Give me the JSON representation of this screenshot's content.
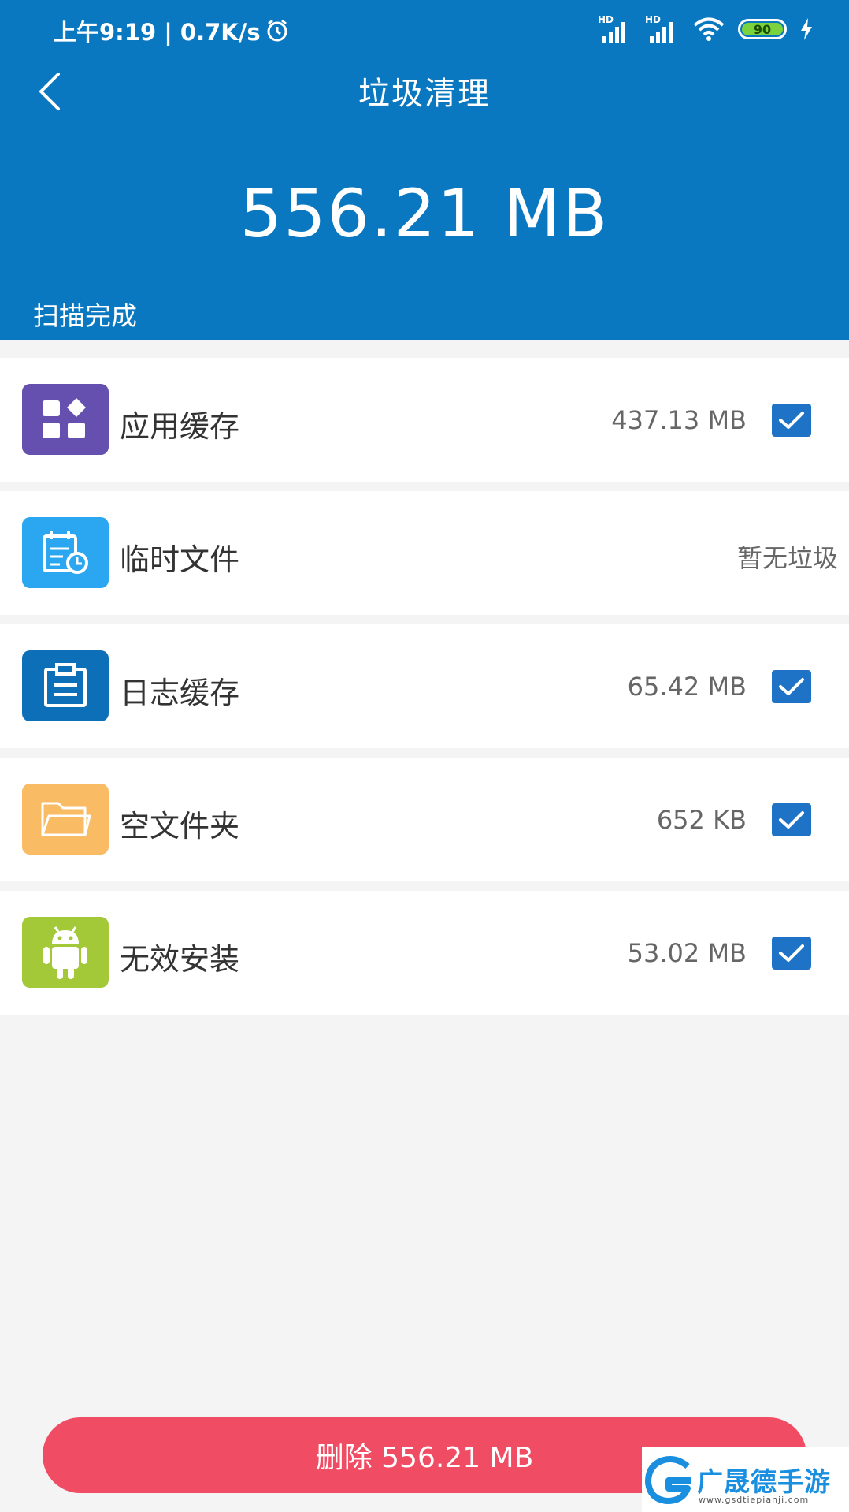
{
  "status_bar": {
    "time_speed": "上午9:19 | 0.7K/s",
    "sim1_label": "HD",
    "sim2_label": "HD",
    "battery": "90"
  },
  "header": {
    "title": "垃圾清理",
    "total_size": "556.21 MB",
    "scan_status": "扫描完成"
  },
  "items": [
    {
      "label": "应用缓存",
      "size": "437.13 MB",
      "checked": true,
      "color": "#6550b0"
    },
    {
      "label": "临时文件",
      "size": "暂无垃圾",
      "checked": false,
      "color": "#2aa7f0"
    },
    {
      "label": "日志缓存",
      "size": "65.42 MB",
      "checked": true,
      "color": "#0c6fb8"
    },
    {
      "label": "空文件夹",
      "size": "652 KB",
      "checked": true,
      "color": "#f9bb64"
    },
    {
      "label": "无效安装",
      "size": "53.02 MB",
      "checked": true,
      "color": "#a3c939"
    }
  ],
  "footer": {
    "delete_label": "删除 556.21 MB"
  },
  "watermark": {
    "text": "广晟德手游",
    "url": "www.gsdtiepianji.com"
  }
}
